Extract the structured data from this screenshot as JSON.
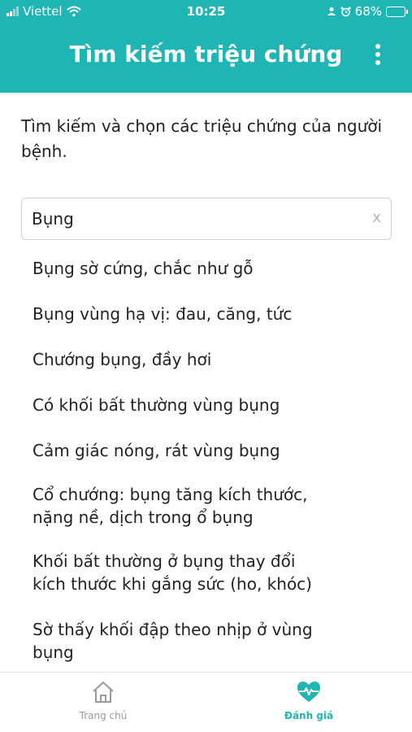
{
  "status_bar": {
    "carrier": "Viettel",
    "time": "10:25",
    "battery": "68%",
    "battery_level": 0.68
  },
  "header": {
    "title": "Tìm kiếm triệu chứng"
  },
  "instruction": "Tìm kiếm và chọn các triệu chứng của người bệnh.",
  "search": {
    "value": "Bụng",
    "clear_label": "x"
  },
  "results": [
    {
      "label": "Bụng sờ cứng, chắc như gỗ"
    },
    {
      "label": "Bụng vùng hạ vị: đau, căng, tức"
    },
    {
      "label": "Chướng bụng, đầy hơi"
    },
    {
      "label": "Có khối bất thường vùng bụng"
    },
    {
      "label": "Cảm giác nóng, rát vùng bụng"
    },
    {
      "label": "Cổ chướng: bụng tăng kích thước, nặng nề, dịch trong ổ bụng"
    },
    {
      "label": "Khối bất thường ở bụng thay đổi kích thước khi gắng sức (ho, khóc)"
    },
    {
      "label": "Sờ thấy khối đập theo nhịp ở vùng bụng"
    }
  ],
  "bottom_nav": {
    "home": {
      "label": "Trang chủ",
      "icon": "home-icon"
    },
    "evaluate": {
      "label": "Đánh giá",
      "icon": "heartbeat-icon",
      "active": true
    }
  },
  "colors": {
    "primary": "#1fb5b5",
    "inactive": "#9a9a9a"
  }
}
